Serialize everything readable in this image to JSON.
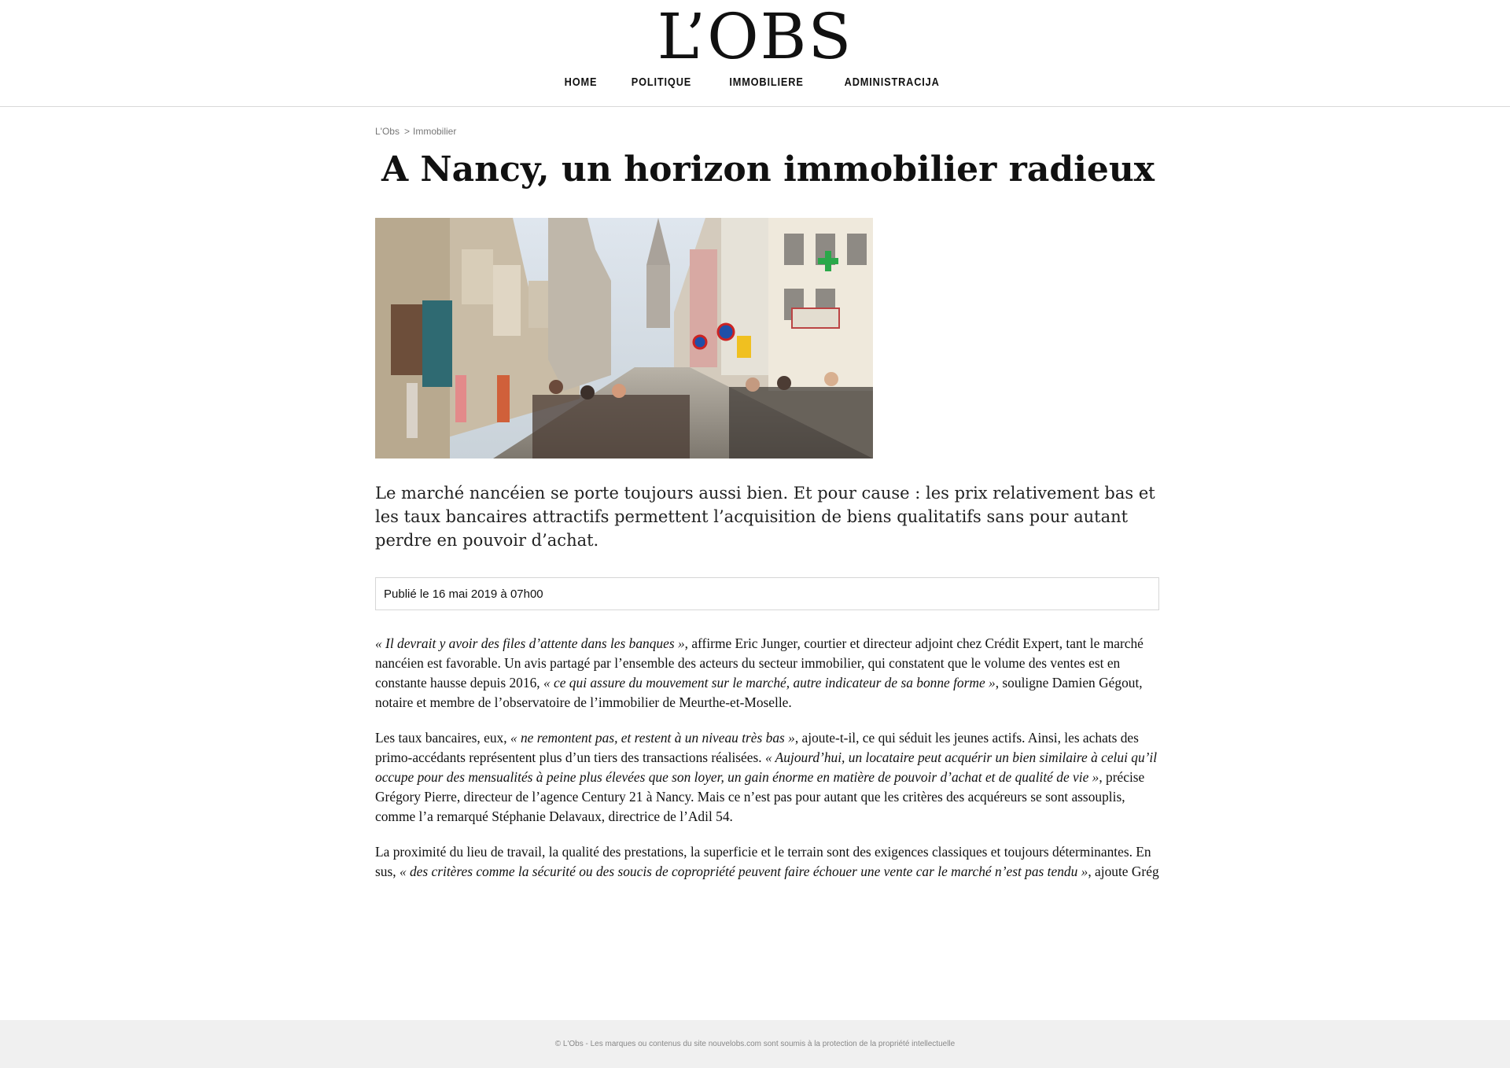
{
  "site": {
    "logo": "L’OBS"
  },
  "nav": [
    "HOME",
    "POLITIQUE",
    "IMMOBILIERE",
    "ADMINISTRACIJA"
  ],
  "breadcrumb": {
    "home": "L'Obs",
    "sep": ">",
    "section": "Immobilier"
  },
  "article": {
    "title": "A Nancy, un horizon immobilier radieux",
    "lead": "Le marché nancéien se porte toujours aussi bien. Et pour cause : les prix relativement bas et les taux bancaires attractifs permettent l’acquisition de biens qualitatifs sans pour autant perdre en pouvoir d’achat.",
    "published": "Publié le 16 mai 2019 à 07h00",
    "p1": {
      "q1": "« Il devrait y avoir des files d’attente dans les banques »",
      "t1": ", affirme Eric Junger, courtier et directeur adjoint chez Crédit Expert, tant le marché nancéien est favorable. Un avis partagé par l’ensemble des acteurs du secteur immobilier, qui constatent que le volume des ventes est en constante hausse depuis 2016, ",
      "q2": "« ce qui assure du mouvement sur le marché, autre indicateur de sa bonne forme »",
      "t2": ", souligne Damien Gégout, notaire et membre de l’observatoire de l’immobilier de Meurthe-et-Moselle."
    },
    "p2": {
      "t1": "Les taux bancaires, eux, ",
      "q1": "« ne remontent pas, et restent à un niveau très bas »",
      "t2": ", ajoute-t-il, ce qui séduit les jeunes actifs. Ainsi, les achats des primo-accédants représentent plus d’un tiers des transactions réalisées. ",
      "q2": "« Aujourd’hui, un locataire peut acquérir un bien similaire à celui qu’il occupe pour des mensualités à peine plus élevées que son loyer, un gain énorme en matière de pouvoir d’achat et de qualité de vie »",
      "t3": ", précise Grégory Pierre, directeur de l’agence Century 21 à Nancy. Mais ce n’est pas pour autant que les critères des acquéreurs se sont assouplis, comme l’a remarqué Stéphanie Delavaux, directrice de l’Adil 54."
    },
    "p3": {
      "t1": "La proximité du lieu de travail, la qualité des prestations, la superficie et le terrain sont des exigences classiques et toujours déterminantes. En sus, ",
      "q1": "« des critères comme la sécurité ou des soucis de copropriété peuvent faire échouer une vente car le marché n’est pas tendu »",
      "t2": ", ajoute Grég"
    }
  },
  "footer": "© L'Obs - Les marques ou contenus du site nouvelobs.com sont soumis à la protection de la propriété intellectuelle"
}
